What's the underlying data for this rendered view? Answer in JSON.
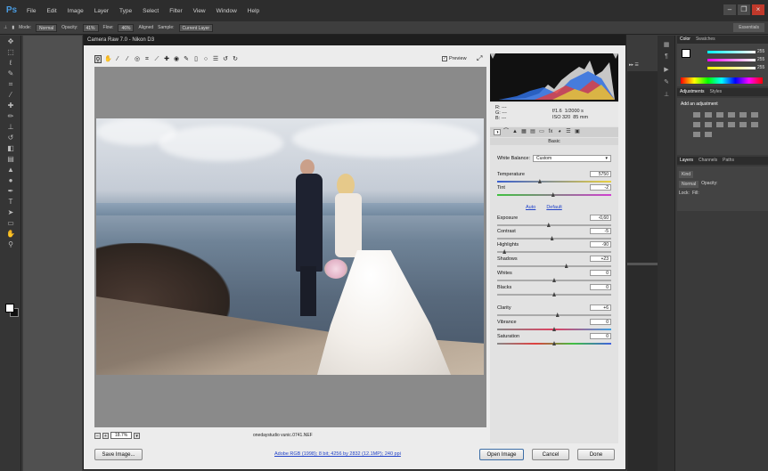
{
  "app": {
    "logo": "Ps"
  },
  "menu": [
    "File",
    "Edit",
    "Image",
    "Layer",
    "Type",
    "Select",
    "Filter",
    "View",
    "Window",
    "Help"
  ],
  "options": {
    "mode_label": "Mode:",
    "mode": "Normal",
    "opacity_label": "Opacity:",
    "opacity": "41%",
    "flow_label": "Flow:",
    "flow": "46%",
    "aligned": "Aligned",
    "sample_label": "Sample:",
    "sample": "Current Layer",
    "workspace": "Essentials"
  },
  "dialog": {
    "title": "Camera Raw 7.0 - Nikon D3",
    "preview_label": "Preview",
    "zoom": "18.7%",
    "filename": "onedaystudio vunic.0741.NEF",
    "workflow": "Adobe RGB (1998); 8 bit; 4256 by 2832 (12.1MP); 240 ppi",
    "buttons": {
      "save": "Save Image...",
      "open": "Open Image",
      "cancel": "Cancel",
      "done": "Done"
    }
  },
  "camera_info": {
    "r": "R:",
    "g": "G:",
    "b": "B:",
    "dash": "---",
    "aperture": "f/1.6",
    "shutter": "1/2000 s",
    "iso": "ISO 320",
    "lens": "85 mm"
  },
  "panel": {
    "title": "Basic",
    "wb_label": "White Balance:",
    "wb_value": "Custom",
    "auto": "Auto",
    "default": "Default",
    "sliders": [
      {
        "label": "Temperature",
        "value": "5750",
        "pos": 0.37
      },
      {
        "label": "Tint",
        "value": "-2",
        "pos": 0.49
      },
      {
        "label": "Exposure",
        "value": "-0,60",
        "pos": 0.45
      },
      {
        "label": "Contrast",
        "value": "-5",
        "pos": 0.48
      },
      {
        "label": "Highlights",
        "value": "-90",
        "pos": 0.05
      },
      {
        "label": "Shadows",
        "value": "+23",
        "pos": 0.61
      },
      {
        "label": "Whites",
        "value": "0",
        "pos": 0.5
      },
      {
        "label": "Blacks",
        "value": "0",
        "pos": 0.5
      },
      {
        "label": "Clarity",
        "value": "+6",
        "pos": 0.53
      },
      {
        "label": "Vibrance",
        "value": "0",
        "pos": 0.5
      },
      {
        "label": "Saturation",
        "value": "0",
        "pos": 0.5
      }
    ]
  },
  "right_panels": {
    "color_tab": "Color",
    "swatches_tab": "Swatches",
    "color_values": [
      "255",
      "255",
      "255"
    ],
    "adjustments_tab": "Adjustments",
    "styles_tab": "Styles",
    "add_adjustment": "Add an adjustment",
    "layers_tab": "Layers",
    "channels_tab": "Channels",
    "paths_tab": "Paths",
    "kind": "Kind",
    "blend": "Normal",
    "opacity_label": "Opacity:",
    "lock_label": "Lock:",
    "fill_label": "Fill:"
  }
}
